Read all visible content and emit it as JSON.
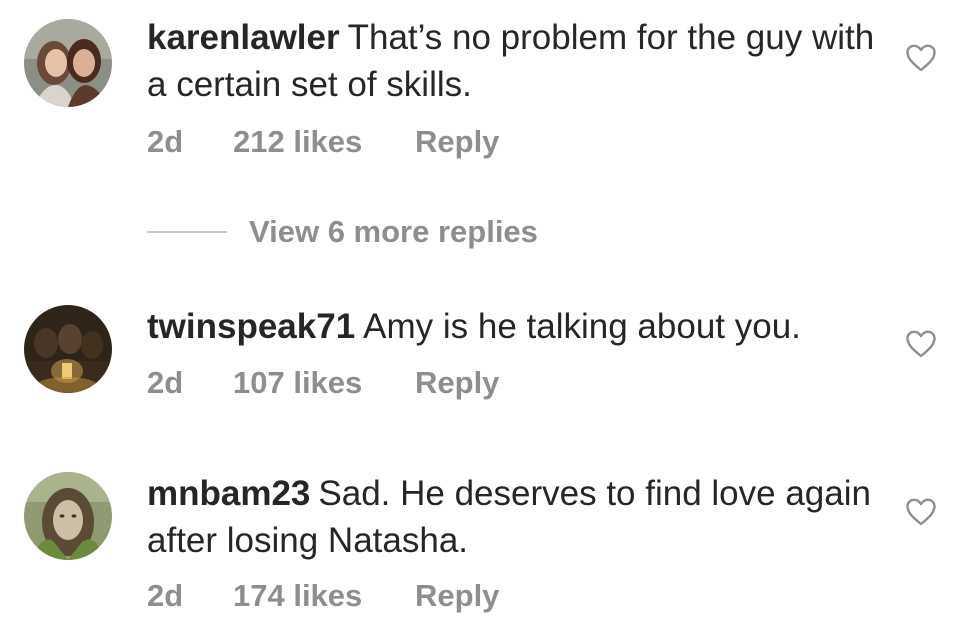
{
  "comments": [
    {
      "username": "karenlawler",
      "text": "That’s no problem for the guy with a certain set of skills.",
      "age": "2d",
      "likes": "212 likes",
      "reply": "Reply",
      "avatar_icon": "user-avatar-two-women"
    },
    {
      "username": "twinspeak71",
      "text": "Amy is he talking about you.",
      "age": "2d",
      "likes": "107 likes",
      "reply": "Reply",
      "avatar_icon": "user-avatar-candlelit"
    },
    {
      "username": "mnbam23",
      "text": "Sad. He deserves to find love again after losing Natasha.",
      "age": "2d",
      "likes": "174 likes",
      "reply": "Reply",
      "avatar_icon": "user-avatar-portrait"
    }
  ],
  "view_more_replies": "View 6 more replies",
  "icons": {
    "like": "heart-outline-icon"
  },
  "colors": {
    "text": "#262626",
    "secondary": "#8e8e8e",
    "divider": "#c7c7c7",
    "background": "#ffffff"
  }
}
